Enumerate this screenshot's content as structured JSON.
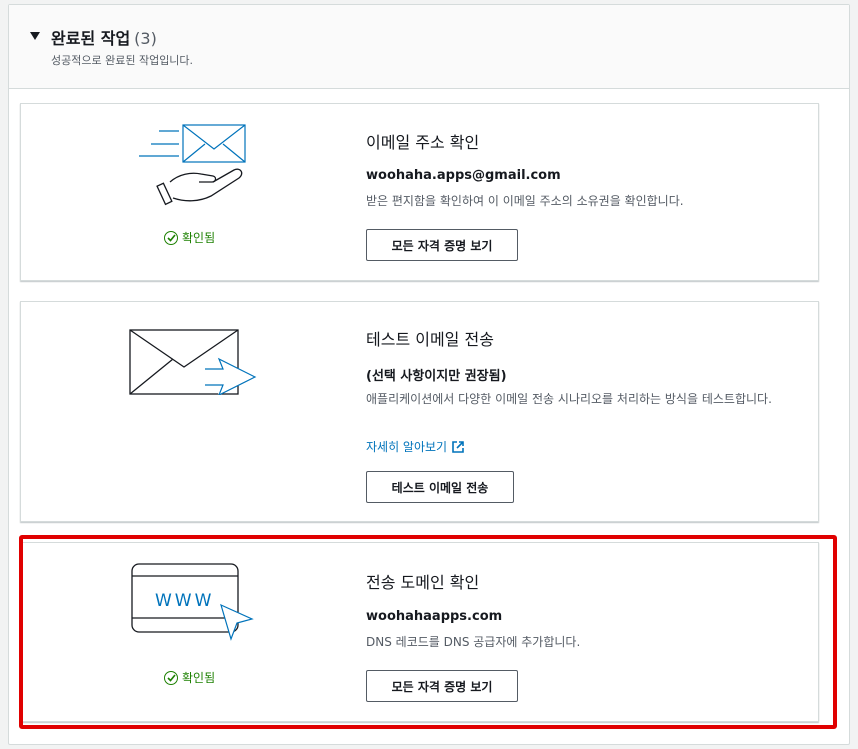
{
  "section": {
    "title": "완료된 작업",
    "count": "(3)",
    "description": "성공적으로 완료된 작업입니다."
  },
  "cards": [
    {
      "icon": "email-verify-illustration",
      "status": "확인됨",
      "title": "이메일 주소 확인",
      "strong": "woohaha.apps@gmail.com",
      "text": "받은 편지함을 확인하여 이 이메일 주소의 소유권을 확인합니다.",
      "button": "모든 자격 증명 보기"
    },
    {
      "icon": "send-email-illustration",
      "title": "테스트 이메일 전송",
      "strong": "(선택 사항이지만 권장됨)",
      "text": "애플리케이션에서 다양한 이메일 전송 시나리오를 처리하는 방식을 테스트합니다.",
      "link": "자세히 알아보기",
      "button": "테스트 이메일 전송"
    },
    {
      "icon": "www-domain-illustration",
      "status": "확인됨",
      "title": "전송 도메인 확인",
      "strong": "woohahaapps.com",
      "text": "DNS 레코드를 DNS 공급자에 추가합니다.",
      "button": "모든 자격 증명 보기",
      "www_label": "WWW"
    }
  ],
  "colors": {
    "accent": "#0073bb",
    "success": "#1d8102",
    "highlight": "#e00000"
  }
}
